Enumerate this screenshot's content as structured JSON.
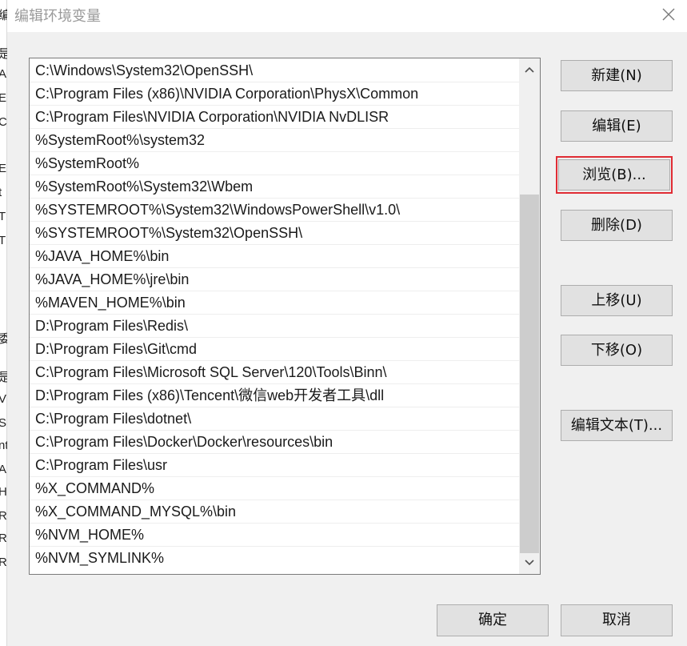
{
  "dialog": {
    "title": "编辑环境变量"
  },
  "paths": [
    "C:\\Windows\\System32\\OpenSSH\\",
    "C:\\Program Files (x86)\\NVIDIA Corporation\\PhysX\\Common",
    "C:\\Program Files\\NVIDIA Corporation\\NVIDIA NvDLISR",
    "%SystemRoot%\\system32",
    "%SystemRoot%",
    "%SystemRoot%\\System32\\Wbem",
    "%SYSTEMROOT%\\System32\\WindowsPowerShell\\v1.0\\",
    "%SYSTEMROOT%\\System32\\OpenSSH\\",
    "%JAVA_HOME%\\bin",
    "%JAVA_HOME%\\jre\\bin",
    "%MAVEN_HOME%\\bin",
    "D:\\Program Files\\Redis\\",
    "D:\\Program Files\\Git\\cmd",
    "C:\\Program Files\\Microsoft SQL Server\\120\\Tools\\Binn\\",
    "D:\\Program Files (x86)\\Tencent\\微信web开发者工具\\dll",
    "C:\\Program Files\\dotnet\\",
    "C:\\Program Files\\Docker\\Docker\\resources\\bin",
    "C:\\Program Files\\usr",
    "%X_COMMAND%",
    "%X_COMMAND_MYSQL%\\bin",
    "%NVM_HOME%",
    "%NVM_SYMLINK%"
  ],
  "buttons": {
    "new": "新建(N)",
    "edit": "编辑(E)",
    "browse": "浏览(B)...",
    "delete": "删除(D)",
    "move_up": "上移(U)",
    "move_down": "下移(O)",
    "edit_text": "编辑文本(T)...",
    "ok": "确定",
    "cancel": "取消"
  },
  "background_window_chars": [
    "编",
    "是",
    "A",
    "E",
    "C",
    "E",
    "t",
    "T",
    "T",
    "委",
    "是",
    "V",
    "S",
    "nt",
    "A",
    "H",
    "R",
    "R",
    "R"
  ],
  "colors": {
    "highlight_border": "#e02c34",
    "dialog_bg": "#f0f0f0",
    "button_bg": "#e1e1e1"
  }
}
